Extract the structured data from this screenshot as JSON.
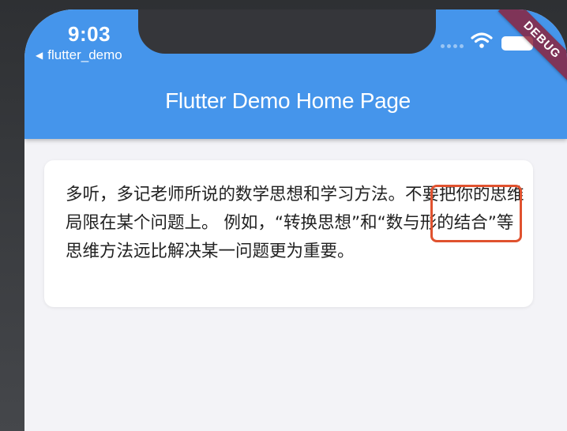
{
  "status_bar": {
    "time": "9:03",
    "back_app_label": "flutter_demo",
    "back_arrow": "◀"
  },
  "debug_banner": {
    "label": "DEBUG"
  },
  "app_bar": {
    "title": "Flutter Demo Home Page",
    "color": "#4595eb"
  },
  "card": {
    "text": "多听，多记老师所说的数学思想和学习方法。不要把你的思维局限在某个问题上。 例如，“转换思想”和“数与形的结合”等思维方法远比解决某一问题更为重要。"
  },
  "annotation": {
    "color": "#e0522f"
  }
}
